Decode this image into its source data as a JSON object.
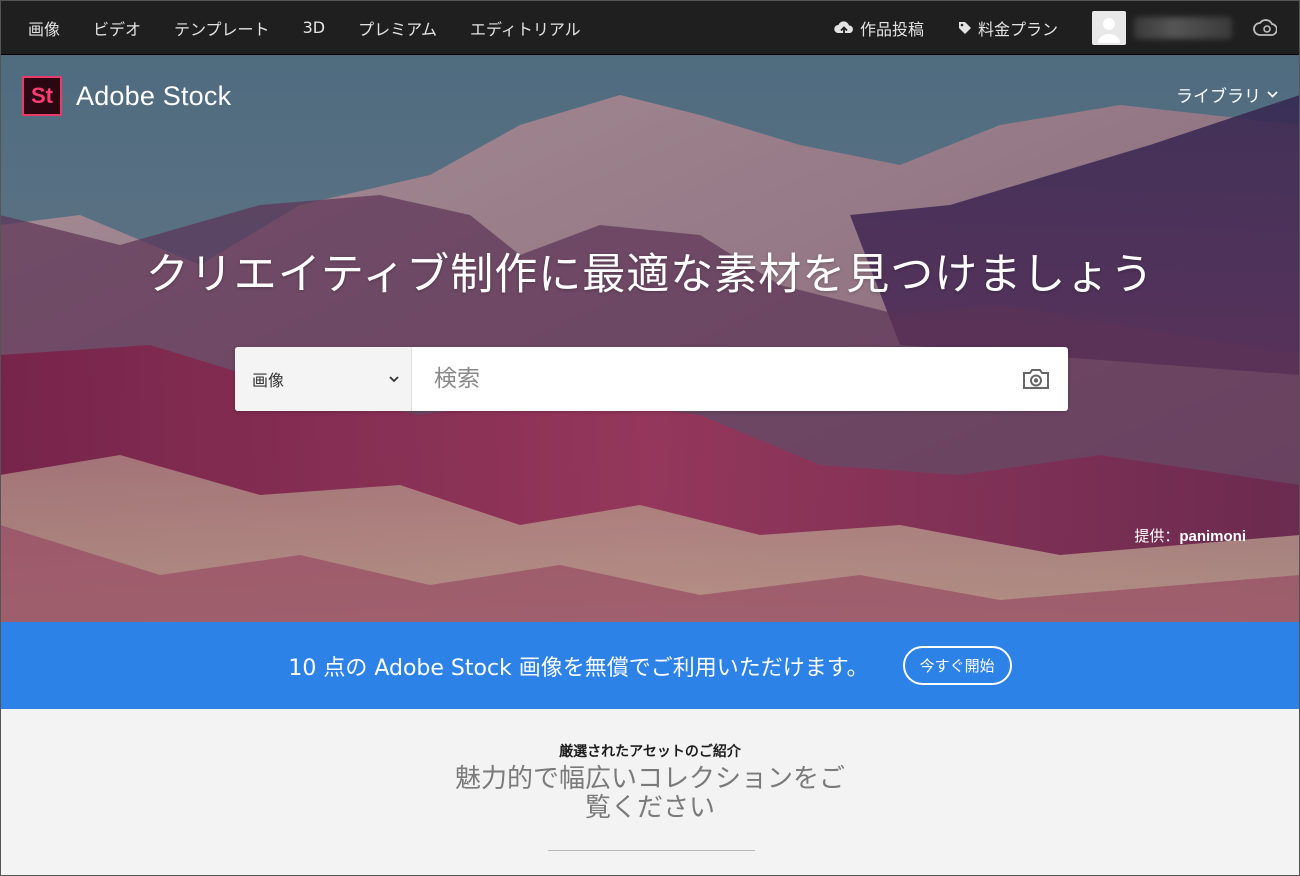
{
  "topnav": {
    "items": [
      {
        "label": "画像"
      },
      {
        "label": "ビデオ"
      },
      {
        "label": "テンプレート"
      },
      {
        "label": "3D"
      },
      {
        "label": "プレミアム"
      },
      {
        "label": "エディトリアル"
      }
    ],
    "upload_label": "作品投稿",
    "pricing_label": "料金プラン",
    "icons": [
      "upload-cloud-icon",
      "tag-icon",
      "user-avatar-icon",
      "creative-cloud-icon"
    ]
  },
  "hero": {
    "brand_logo_text": "St",
    "brand_name": "Adobe Stock",
    "library_label": "ライブラリ",
    "headline": "クリエイティブ制作に最適な素材を見つけましょう",
    "search": {
      "category": "画像",
      "placeholder": "検索"
    },
    "credit_prefix": "提供：",
    "credit_name": "panimoni"
  },
  "promo": {
    "text": "10 点の Adobe Stock 画像を無償でご利用いただけます。",
    "button_label": "今すぐ開始",
    "color": "#2d82e8"
  },
  "featured": {
    "kicker": "厳選されたアセットのご紹介",
    "title": "魅力的で幅広いコレクションをご覧ください"
  },
  "colors": {
    "nav_bg": "#1f1f1f",
    "brand_accent": "#ff3d72",
    "promo_blue": "#2d82e8",
    "section_bg": "#f3f3f3"
  }
}
